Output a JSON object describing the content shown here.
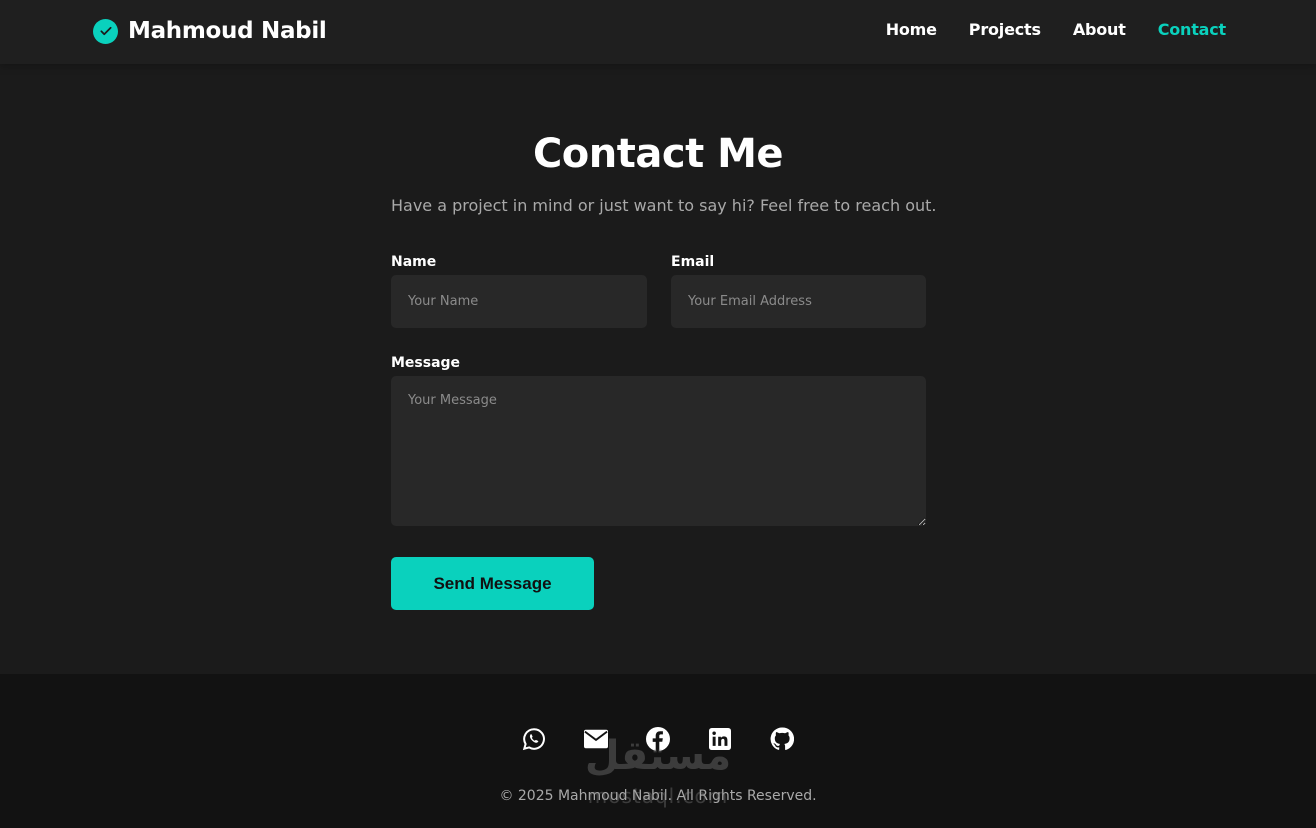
{
  "header": {
    "brand_name": "Mahmoud Nabil",
    "nav": [
      {
        "label": "Home"
      },
      {
        "label": "Projects"
      },
      {
        "label": "About"
      },
      {
        "label": "Contact",
        "active": true
      }
    ]
  },
  "contact": {
    "title": "Contact Me",
    "subtitle": "Have a project in mind or just want to say hi? Feel free to reach out.",
    "name_label": "Name",
    "name_placeholder": "Your Name",
    "email_label": "Email",
    "email_placeholder": "Your Email Address",
    "message_label": "Message",
    "message_placeholder": "Your Message",
    "submit_label": "Send Message"
  },
  "footer": {
    "socials": [
      {
        "icon": "whatsapp-icon"
      },
      {
        "icon": "mail-icon"
      },
      {
        "icon": "facebook-icon"
      },
      {
        "icon": "linkedin-icon"
      },
      {
        "icon": "github-icon"
      }
    ],
    "copyright": "© 2025 Mahmoud Nabil. All Rights Reserved."
  },
  "watermark": {
    "arabic": "مستقل",
    "latin": "mostaql.com"
  },
  "colors": {
    "accent": "#0ad1bd",
    "background": "#1b1b1b",
    "header_bg": "#1f1f1f",
    "footer_bg": "#121212",
    "field_bg": "#282828"
  }
}
